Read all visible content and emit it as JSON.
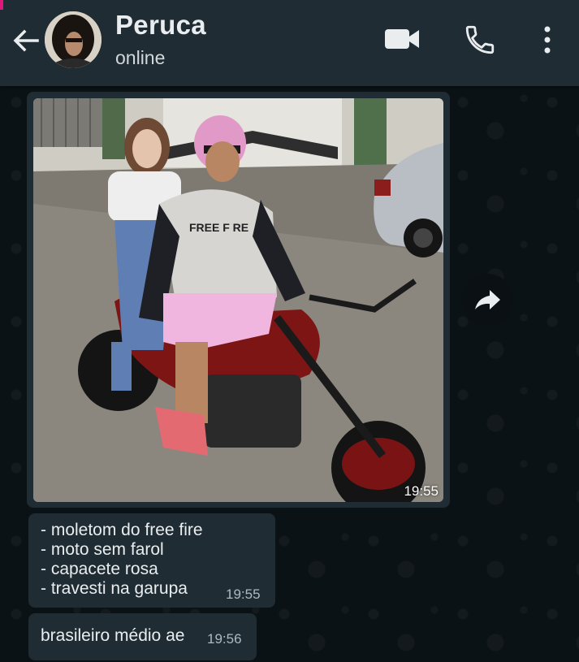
{
  "header": {
    "contact_name": "Peruca",
    "status": "online"
  },
  "icons": {
    "back": "arrow-left-icon",
    "video": "video-camera-icon",
    "call": "phone-icon",
    "menu": "more-vertical-icon",
    "forward": "forward-share-icon"
  },
  "messages": [
    {
      "type": "image",
      "time": "19:55"
    },
    {
      "type": "text",
      "lines": [
        "- moletom do free fire",
        "- moto sem farol",
        "- capacete rosa",
        "- travesti na garupa"
      ],
      "time": "19:55"
    },
    {
      "type": "text",
      "lines": [
        "brasileiro médio ae"
      ],
      "time": "19:56"
    }
  ],
  "colors": {
    "header_bg": "#1f2c33",
    "chat_bg": "#0b1216",
    "bubble_bg": "#1f2c33",
    "text": "#e9edef",
    "secondary_text": "#aebac1"
  }
}
